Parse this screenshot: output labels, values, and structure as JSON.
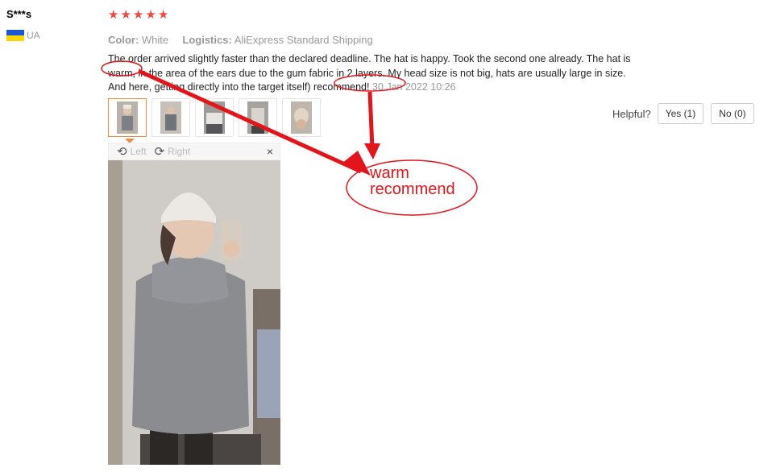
{
  "reviewer": {
    "name": "S***s",
    "country_code": "UA"
  },
  "rating": {
    "stars": 5,
    "max": 5
  },
  "meta": {
    "color_label": "Color:",
    "color_value": "White",
    "logistics_label": "Logistics:",
    "logistics_value": "AliExpress Standard Shipping"
  },
  "review": {
    "text_line1": "The order arrived slightly faster than the declared deadline. The hat is happy. Took the second one already. The hat is",
    "text_line2": "warm, in the area of the ears due to the gum fabric in 2 layers. My head size is not big, hats are usually large in size.",
    "text_line3": "And here, getting directly into the target itself) recommend!",
    "date": "30 Jan 2022 10:26"
  },
  "viewer": {
    "left_label": "Left",
    "right_label": "Right",
    "close_glyph": "×"
  },
  "helpful": {
    "label": "Helpful?",
    "yes_label": "Yes (1)",
    "no_label": "No (0)"
  },
  "annotation": {
    "line1": "warm",
    "line2": "recommend"
  },
  "colors": {
    "star": "#f4473e",
    "annotation": "#e4141b",
    "active_thumb": "#f08a3c"
  }
}
